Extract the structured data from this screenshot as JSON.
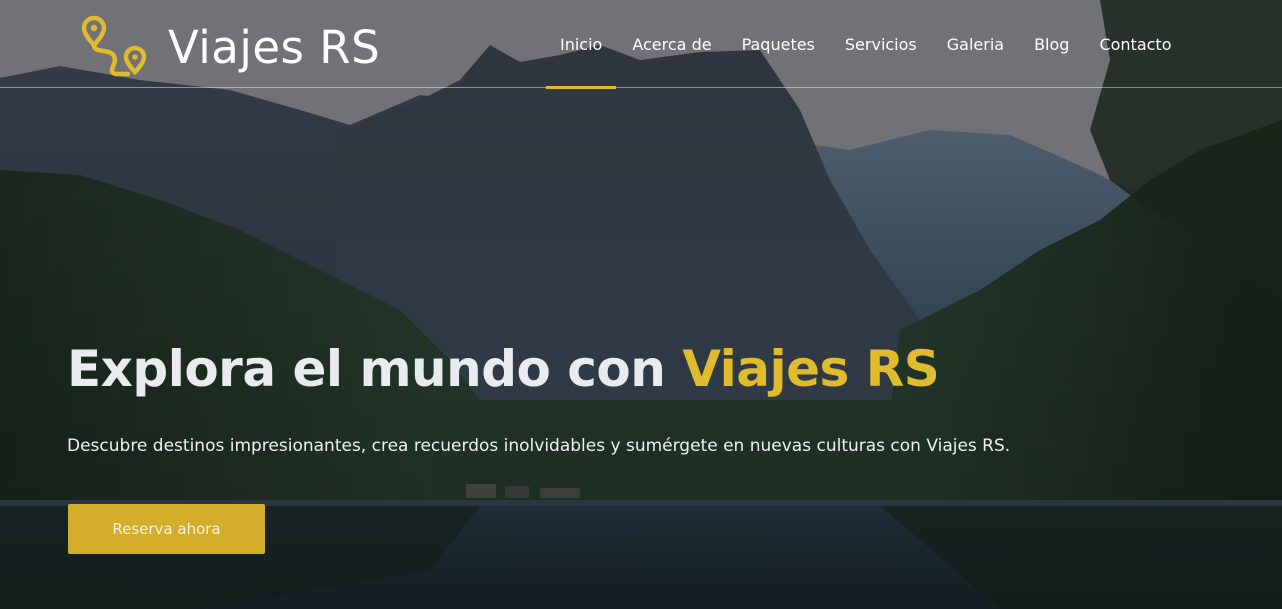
{
  "brand": {
    "name": "Viajes RS",
    "icon": "route-pin-icon",
    "accent_color": "#e0bb2d"
  },
  "nav": {
    "items": [
      {
        "label": "Inicio",
        "active": true
      },
      {
        "label": "Acerca de",
        "active": false
      },
      {
        "label": "Paquetes",
        "active": false
      },
      {
        "label": "Servicios",
        "active": false
      },
      {
        "label": "Galeria",
        "active": false
      },
      {
        "label": "Blog",
        "active": false
      },
      {
        "label": "Contacto",
        "active": false
      }
    ]
  },
  "hero": {
    "title_main": "Explora el mundo con ",
    "title_accent": "Viajes RS",
    "subtitle": "Descubre destinos impresionantes, crea recuerdos inolvidables y sumérgete en nuevas culturas con Viajes RS.",
    "cta_label": "Reserva ahora",
    "cta_color": "#d4ae2b",
    "background": "mountain-lake-forest-photo"
  }
}
